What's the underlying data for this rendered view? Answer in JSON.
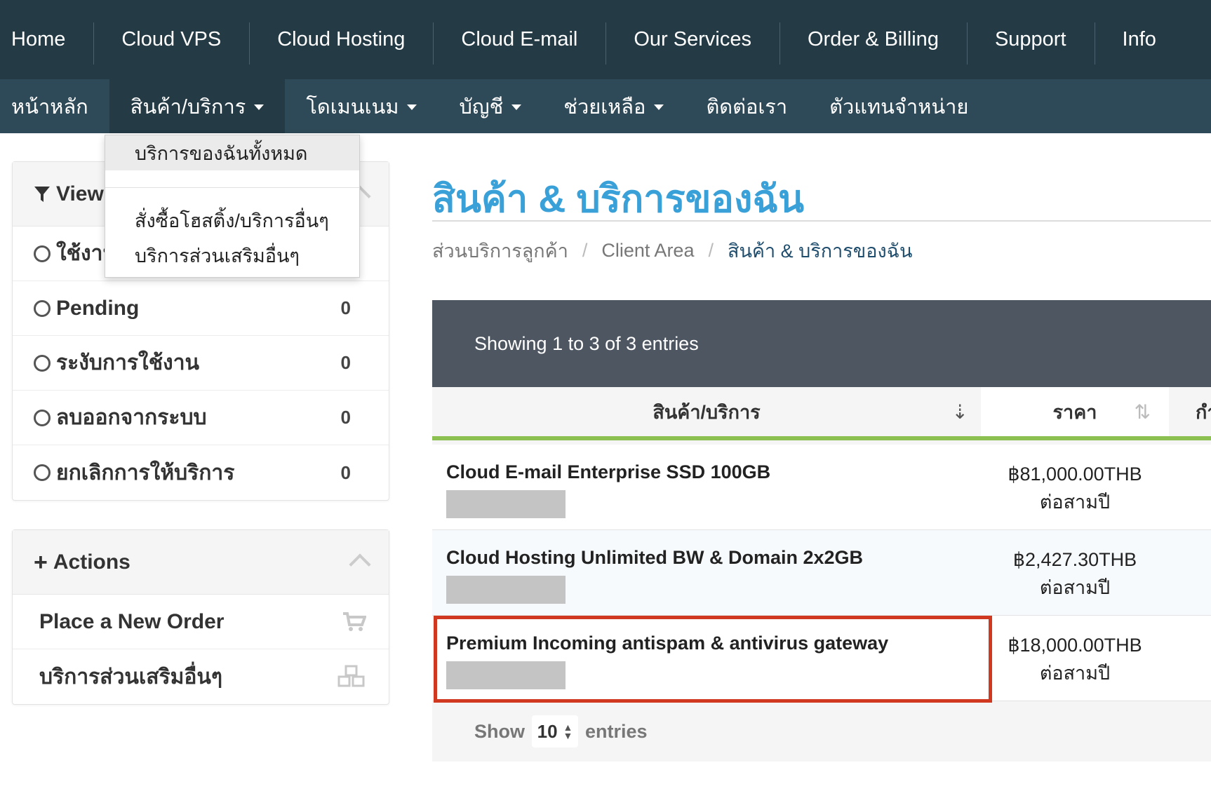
{
  "topnav": {
    "items": [
      "Home",
      "Cloud VPS",
      "Cloud Hosting",
      "Cloud E-mail",
      "Our Services",
      "Order & Billing",
      "Support",
      "Info"
    ]
  },
  "subnav": {
    "items": [
      {
        "label": "หน้าหลัก",
        "caret": false
      },
      {
        "label": "สินค้า/บริการ",
        "caret": true
      },
      {
        "label": "โดเมนเนม",
        "caret": true
      },
      {
        "label": "บัญชี",
        "caret": true
      },
      {
        "label": "ช่วยเหลือ",
        "caret": true
      },
      {
        "label": "ติดต่อเรา",
        "caret": false
      },
      {
        "label": "ตัวแทนจำหน่าย",
        "caret": false
      }
    ]
  },
  "dropdown": {
    "items": [
      "บริการของฉันทั้งหมด",
      "สั่งซื้อโฮสติ้ง/บริการอื่นๆ",
      "บริการส่วนเสริมอื่นๆ"
    ]
  },
  "view_panel": {
    "title": "View",
    "rows": [
      {
        "label": "ใช้งาน",
        "count": ""
      },
      {
        "label": "Pending",
        "count": "0"
      },
      {
        "label": "ระงับการใช้งาน",
        "count": "0"
      },
      {
        "label": "ลบออกจากระบบ",
        "count": "0"
      },
      {
        "label": "ยกเลิกการให้บริการ",
        "count": "0"
      }
    ]
  },
  "actions_panel": {
    "title": "Actions",
    "rows": [
      {
        "label": "Place a New Order",
        "icon": "cart-icon"
      },
      {
        "label": "บริการส่วนเสริมอื่นๆ",
        "icon": "cubes-icon"
      }
    ]
  },
  "main": {
    "title": "สินค้า & บริการของฉัน",
    "breadcrumb": [
      "ส่วนบริการลูกค้า",
      "Client Area",
      "สินค้า & บริการของฉัน"
    ],
    "table": {
      "info": "Showing 1 to 3 of 3 entries",
      "columns": [
        "สินค้า/บริการ",
        "ราคา",
        "กำ"
      ],
      "rows": [
        {
          "name": "Cloud E-mail Enterprise SSD 100GB",
          "price": "฿81,000.00THB",
          "cycle": "ต่อสามปี"
        },
        {
          "name": "Cloud Hosting Unlimited BW & Domain 2x2GB",
          "price": "฿2,427.30THB",
          "cycle": "ต่อสามปี"
        },
        {
          "name": "Premium Incoming antispam & antivirus gateway",
          "price": "฿18,000.00THB",
          "cycle": "ต่อสามปี"
        }
      ],
      "footer": {
        "show": "Show",
        "page_size": "10",
        "entries": "entries"
      }
    }
  },
  "colors": {
    "topnav_bg": "#243a45",
    "subnav_bg": "#2e4957",
    "title_blue": "#3aa0d8",
    "highlight_red": "#d0381f",
    "sort_green": "#8cc152"
  }
}
